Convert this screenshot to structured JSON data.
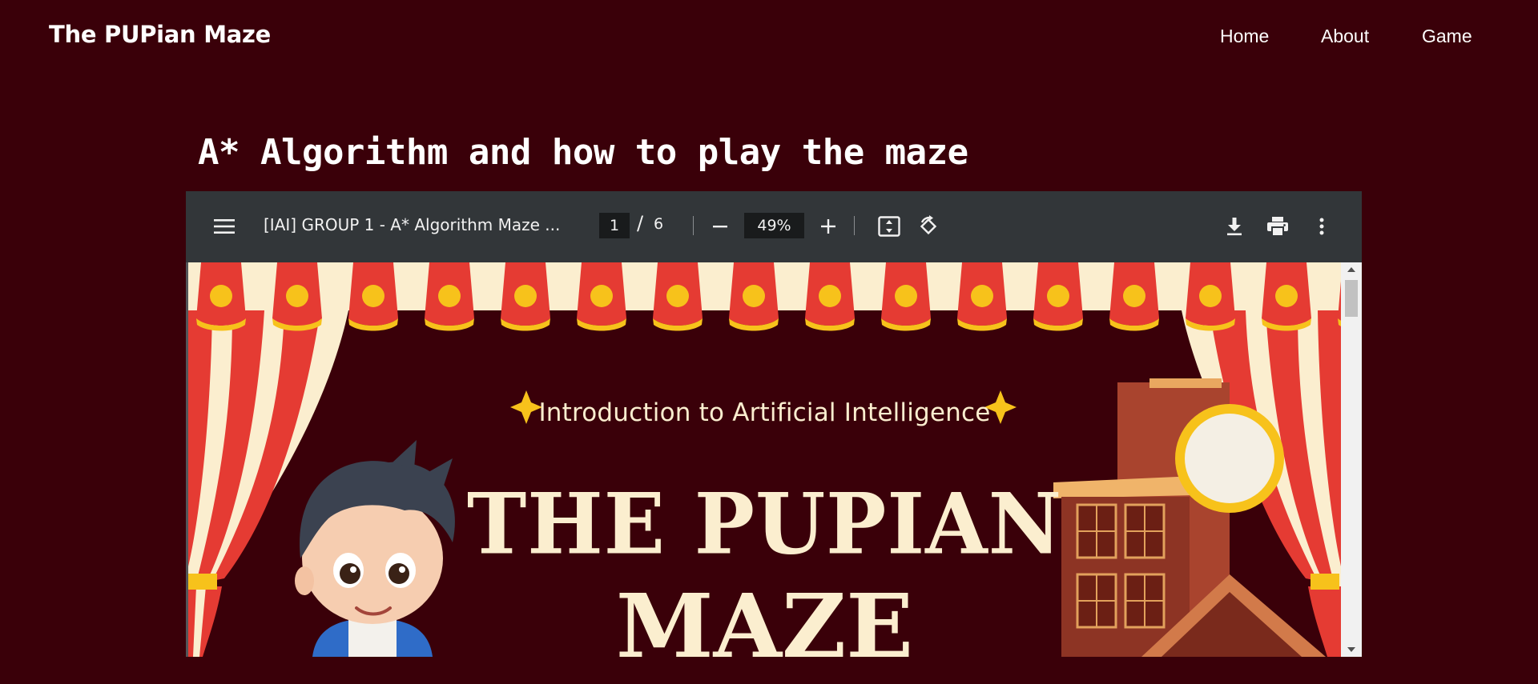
{
  "site": {
    "brand": "The PUPian Maze",
    "nav": [
      {
        "label": "Home"
      },
      {
        "label": "About"
      },
      {
        "label": "Game"
      }
    ]
  },
  "main": {
    "title": "A* Algorithm and how to play the maze"
  },
  "pdf_viewer": {
    "document_title": "[IAI] GROUP 1 - A* Algorithm Maze ...",
    "current_page": "1",
    "page_separator": "/",
    "total_pages": "6",
    "zoom": "49%",
    "icons": [
      "menu-icon",
      "zoom-out-icon",
      "zoom-in-icon",
      "fit-page-icon",
      "rotate-icon",
      "download-icon",
      "print-icon",
      "more-vert-icon"
    ]
  },
  "slide": {
    "subtitle": "Introduction to Artificial Intelligence",
    "title_line_1": "THE PUPIAN",
    "title_line_2": "MAZE",
    "colors": {
      "background": "#3a0009",
      "curtain_red": "#e53b33",
      "curtain_cream": "#fbeecf",
      "gold": "#f7c21b",
      "text": "#fbeecf"
    }
  }
}
